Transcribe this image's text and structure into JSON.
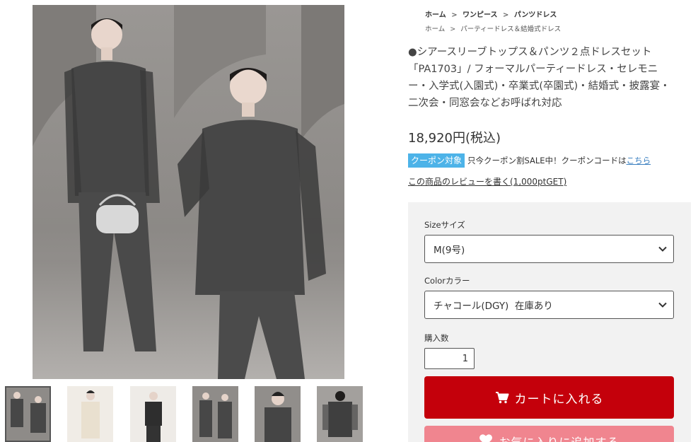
{
  "breadcrumbs": {
    "row1": [
      "ホーム",
      "ワンピース",
      "パンツドレス"
    ],
    "row2": [
      "ホーム",
      "パーティードレス＆結婚式ドレス"
    ],
    "separator": ">"
  },
  "product": {
    "title": "●シアースリーブトップス＆パンツ２点ドレスセット「PA1703」/ フォーマルパーティードレス・セレモニー・入学式(入園式)・卒業式(卒園式)・結婚式・披露宴・二次会・同窓会などお呼ばれ対応",
    "price": "18,920円(税込)",
    "coupon_badge": "クーポン対象",
    "coupon_text": "只今クーポン割SALE中！クーポンコードは",
    "coupon_link": "こちら",
    "review_link": "この商品のレビューを書く(1,000ptGET)"
  },
  "purchase": {
    "size_label": "Sizeサイズ",
    "size_value": "M(9号)",
    "color_label": "Colorカラー",
    "color_value": "チャコール(DGY)  在庫あり",
    "qty_label": "購入数",
    "qty_value": "1",
    "cart_button": "カートに入れる",
    "favorite_button": "お気に入りに追加する"
  },
  "gallery": {
    "thumbnails": [
      "thumb-1",
      "thumb-2",
      "thumb-3",
      "thumb-4",
      "thumb-5",
      "thumb-6"
    ],
    "active_index": 0
  },
  "colors": {
    "cart": "#c4000b",
    "favorite": "#f0858f",
    "coupon": "#4db3e8",
    "panel": "#f2f2f2"
  },
  "icons": {
    "cart": "cart-icon",
    "favorite": "heart-icon",
    "dropdown": "chevron-down-icon"
  }
}
